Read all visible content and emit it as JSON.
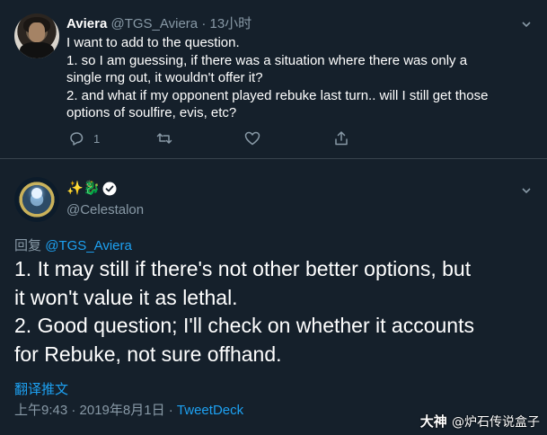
{
  "tweet1": {
    "display_name": "Aviera",
    "handle": "@TGS_Aviera",
    "separator": "·",
    "time": "13小时",
    "lines": [
      "I want to add to the question.",
      "1. so I am guessing, if there was a situation where there was only a",
      "single rng out, it wouldn't offer it?",
      "2. and what if my opponent played rebuke last turn.. will I still get those",
      "options of soulfire, evis, etc?"
    ],
    "reply_count": "1",
    "icons": [
      "reply-icon",
      "retweet-icon",
      "like-icon",
      "share-icon",
      "chevron-down-icon"
    ]
  },
  "tweet2": {
    "emoji_name": "✨🐉",
    "handle": "@Celestalon",
    "reply_prefix": "回复",
    "reply_to": "@TGS_Aviera",
    "lines": [
      "1. It may still if there's not other better options, but",
      "it won't value it as lethal.",
      "2. Good question; I'll check on whether it accounts",
      "for Rebuke, not sure offhand."
    ],
    "translate_label": "翻译推文",
    "timestamp": "上午9:43 · 2019年8月1日 · ",
    "source": "TweetDeck",
    "icons": [
      "verified-badge-icon",
      "chevron-down-icon"
    ]
  },
  "watermark": {
    "brand": "大神",
    "sub": "@炉石传说盒子"
  },
  "colors": {
    "background": "#15202b",
    "divider": "#38444d",
    "muted": "#8899a6",
    "link": "#1da1f2",
    "text": "#ffffff"
  }
}
